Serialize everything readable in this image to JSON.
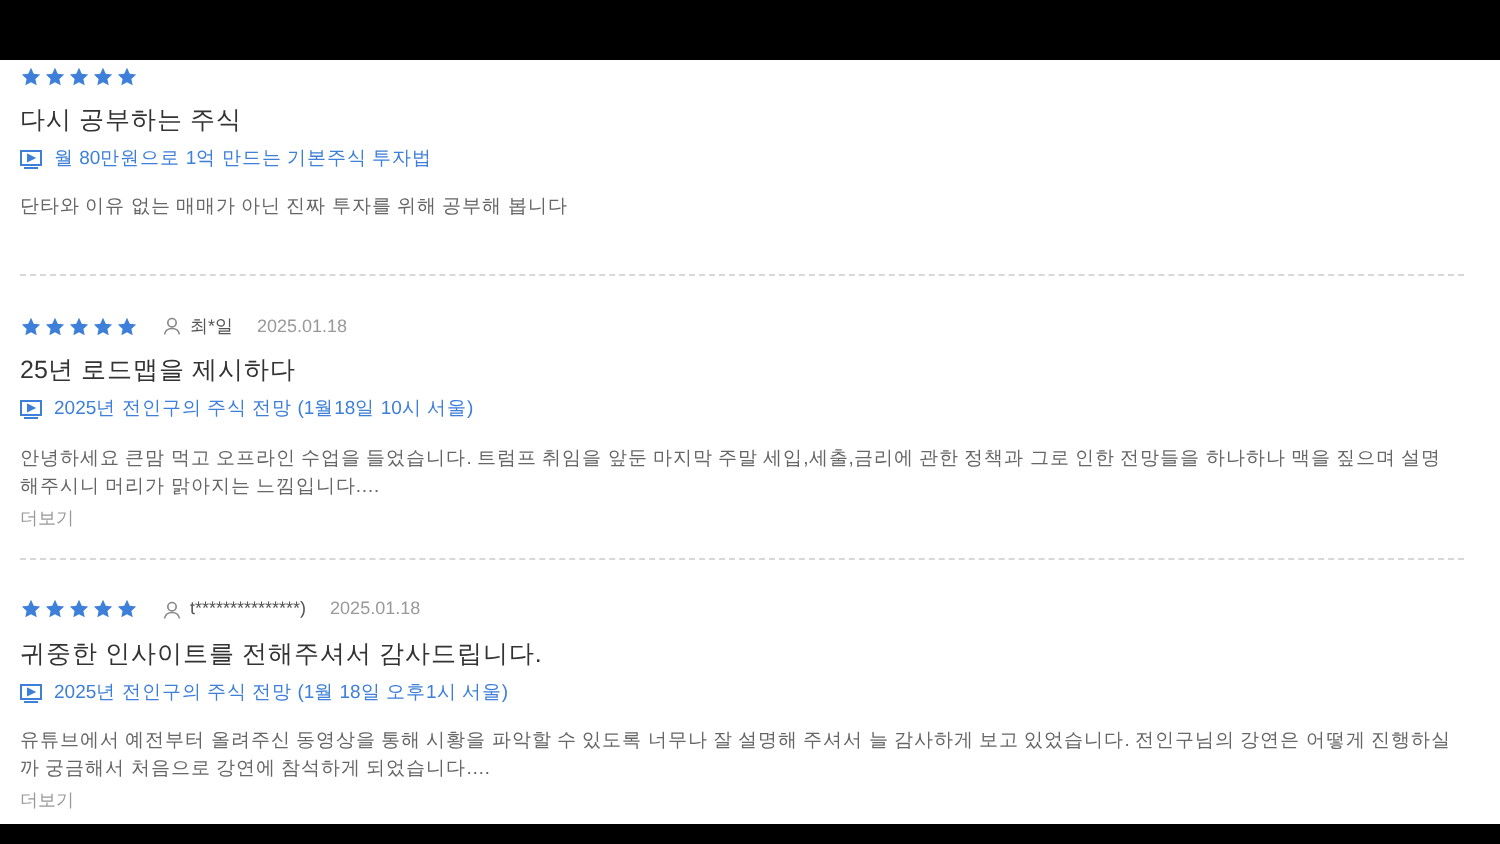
{
  "reviews": [
    {
      "stars": 5,
      "title": "다시 공부하는 주식",
      "course": "월 80만원으로 1억 만드는 기본주식 투자법",
      "body": "단타와 이유 없는 매매가 아닌 진짜 투자를 위해 공부해 봅니다"
    },
    {
      "stars": 5,
      "author": "최*일",
      "date": "2025.01.18",
      "title": "25년 로드맵을 제시하다",
      "course": "2025년 전인구의 주식 전망 (1월18일 10시 서울)",
      "body": "안녕하세요 큰맘 먹고 오프라인 수업을 들었습니다. 트럼프 취임을 앞둔 마지막 주말 세입,세출,금리에 관한 정책과 그로 인한 전망들을 하나하나 맥을 짚으며 설명해주시니 머리가 맑아지는 느낌입니다.…",
      "more": "더보기"
    },
    {
      "stars": 5,
      "author": "t***************)",
      "date": "2025.01.18",
      "title": "귀중한 인사이트를 전해주셔서 감사드립니다.",
      "course": "2025년 전인구의 주식 전망 (1월 18일 오후1시 서울)",
      "body": "유튜브에서 예전부터 올려주신 동영상을 통해 시황을 파악할 수 있도록 너무나 잘 설명해 주셔서 늘 감사하게 보고 있었습니다. 전인구님의 강연은 어떻게 진행하실까 궁금해서 처음으로 강연에 참석하게 되었습니다.…",
      "more": "더보기"
    }
  ]
}
